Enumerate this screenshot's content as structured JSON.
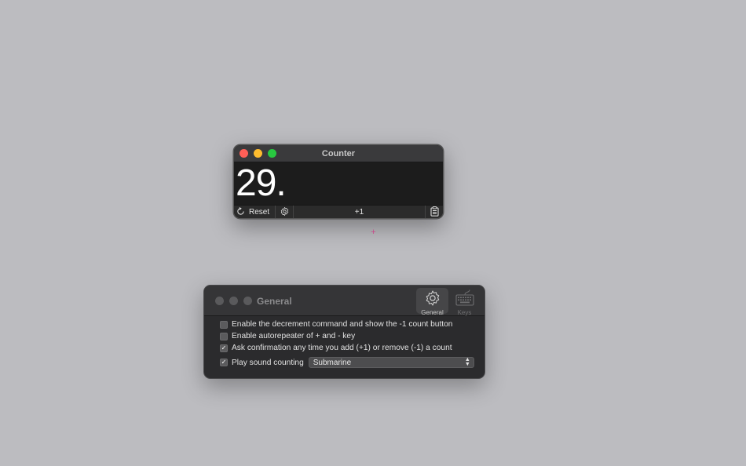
{
  "counter_window": {
    "title": "Counter",
    "count": "29.",
    "reset_label": "Reset",
    "increment_label": "+1"
  },
  "cursor_glyph": "+",
  "prefs_window": {
    "title": "General",
    "toolbar": [
      {
        "label": "General",
        "icon": "gear-icon",
        "selected": true
      },
      {
        "label": "Keys",
        "icon": "keyboard-icon",
        "selected": false
      }
    ],
    "options": {
      "decrement": {
        "label": "Enable the decrement command and show the -1 count button",
        "checked": false
      },
      "autorepeat": {
        "label": "Enable autorepeater of + and - key",
        "checked": false
      },
      "confirm": {
        "label": "Ask confirmation any time you add (+1) or remove (-1) a count",
        "checked": true
      },
      "sound": {
        "label": "Play sound counting",
        "checked": true
      }
    },
    "sound_select": {
      "selected": "Submarine"
    }
  },
  "colors": {
    "desktop": "#bcbcc0",
    "close": "#ff5f57",
    "minimize": "#febc2e",
    "zoom": "#28c840"
  }
}
